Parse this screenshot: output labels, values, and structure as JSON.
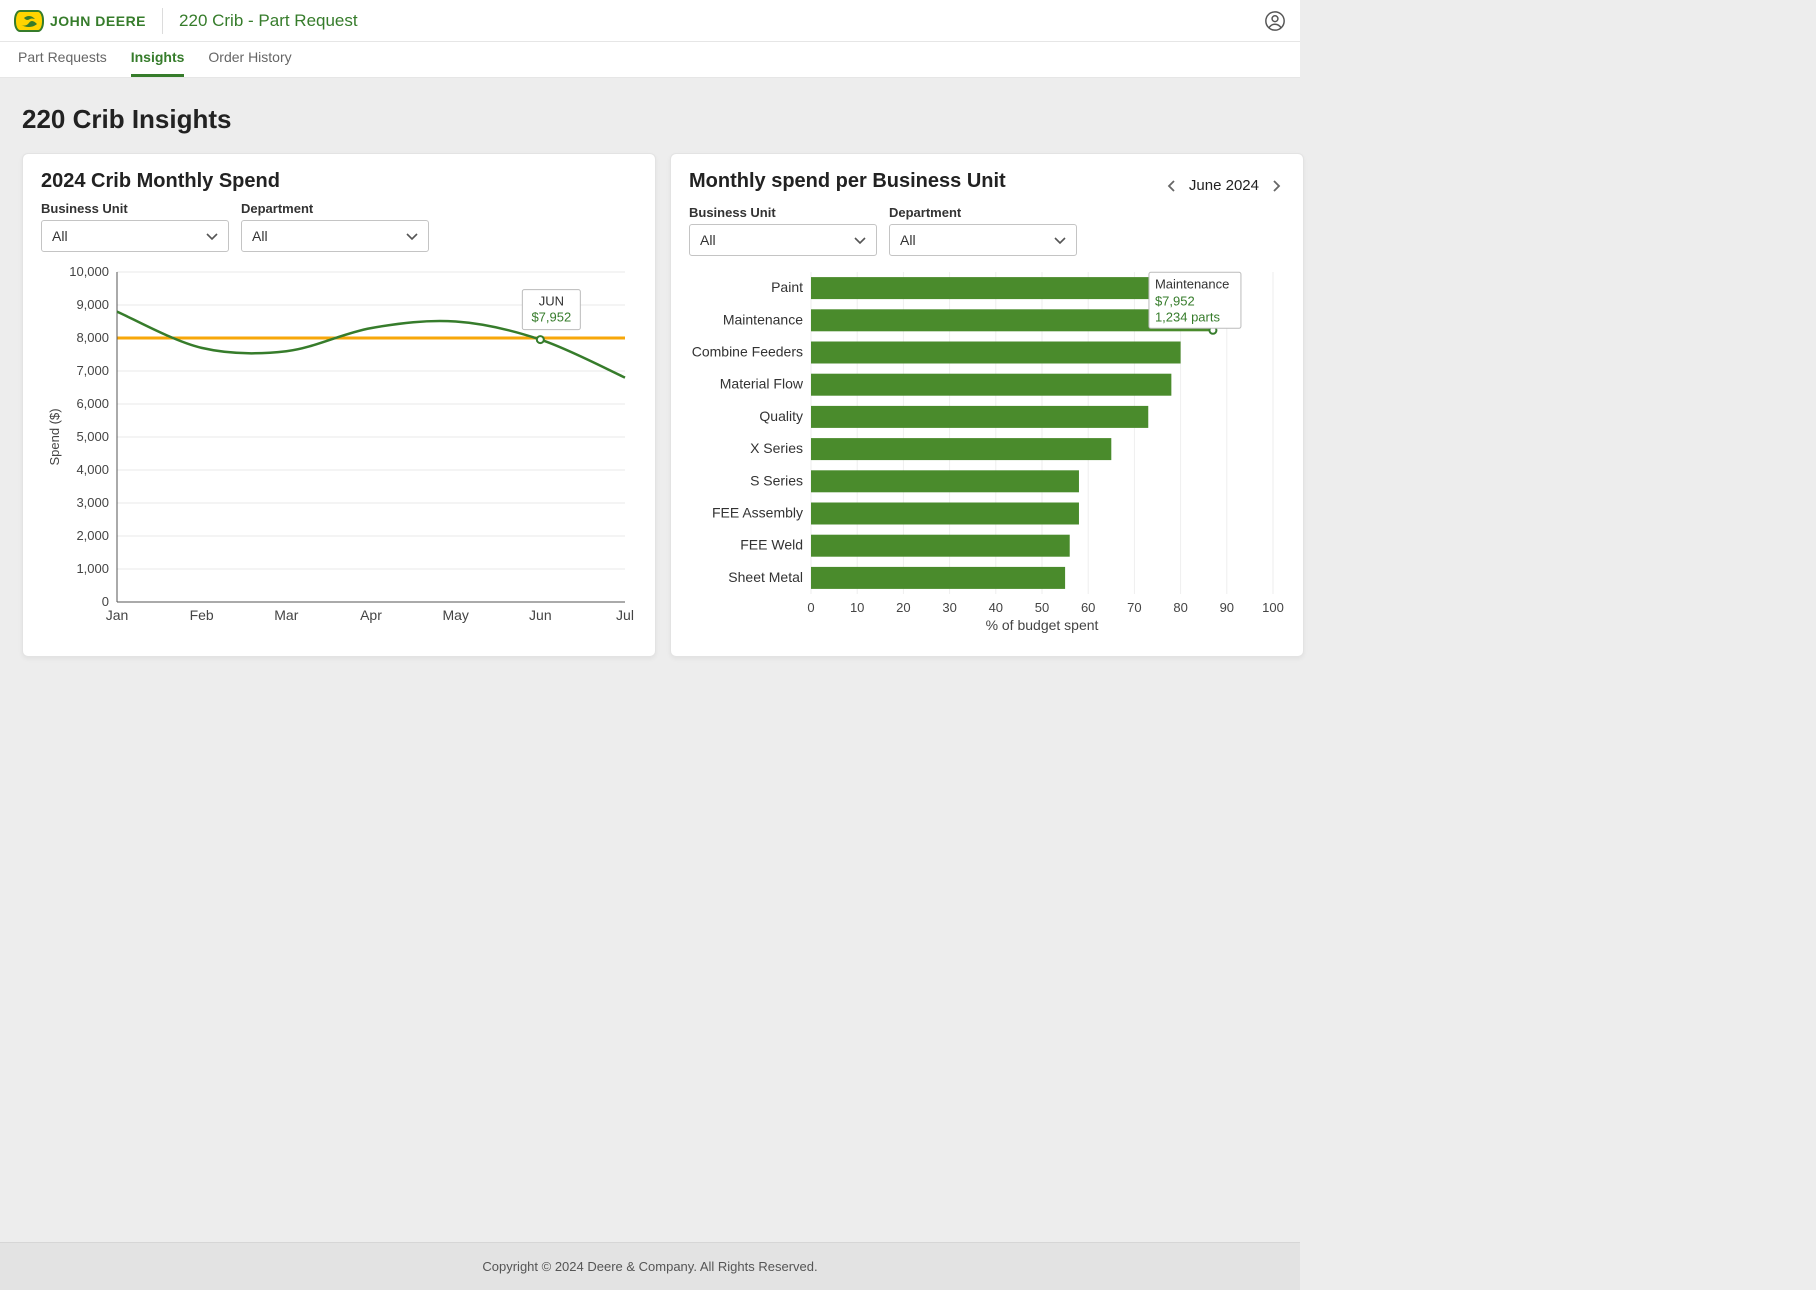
{
  "header": {
    "brand": "JOHN DEERE",
    "title": "220 Crib - Part Request"
  },
  "tabs": [
    {
      "id": "part-requests",
      "label": "Part Requests",
      "active": false
    },
    {
      "id": "insights",
      "label": "Insights",
      "active": true
    },
    {
      "id": "order-history",
      "label": "Order History",
      "active": false
    }
  ],
  "page": {
    "title": "220 Crib Insights"
  },
  "cards": {
    "spend": {
      "title": "2024 Crib Monthly Spend",
      "filters": {
        "business_unit_label": "Business Unit",
        "business_unit_value": "All",
        "department_label": "Department",
        "department_value": "All"
      },
      "tooltip": {
        "label": "JUN",
        "value": "$7,952"
      }
    },
    "bu": {
      "title": "Monthly spend per Business Unit",
      "month_label": "June 2024",
      "filters": {
        "business_unit_label": "Business Unit",
        "business_unit_value": "All",
        "department_label": "Department",
        "department_value": "All"
      },
      "tooltip": {
        "title": "Maintenance",
        "l1": "$7,952",
        "l2": "1,234 parts"
      }
    }
  },
  "footer": {
    "text": "Copyright © 2024 Deere & Company. All Rights Reserved."
  },
  "chart_data": [
    {
      "id": "monthly_spend_line",
      "type": "line",
      "title": "2024 Crib Monthly Spend",
      "xlabel": "",
      "ylabel": "Spend ($)",
      "categories": [
        "Jan",
        "Feb",
        "Mar",
        "Apr",
        "May",
        "Jun",
        "Jul"
      ],
      "values": [
        8800,
        7700,
        7600,
        8300,
        8500,
        7952,
        6800
      ],
      "reference_line": 8000,
      "ylim": [
        0,
        10000
      ],
      "xtick_labels": [
        "Jan",
        "Feb",
        "Mar",
        "Apr",
        "May",
        "Jun",
        "Jul"
      ],
      "ytick_labels": [
        "0",
        "1,000",
        "2,000",
        "3,000",
        "4,000",
        "5,000",
        "6,000",
        "7,000",
        "8,000",
        "9,000",
        "10,000"
      ],
      "highlight": {
        "category": "Jun",
        "label": "JUN",
        "value_label": "$7,952"
      }
    },
    {
      "id": "bu_budget_bar",
      "type": "bar",
      "orientation": "horizontal",
      "title": "Monthly spend per Business Unit",
      "month": "June 2024",
      "xlabel": "% of budget spent",
      "ylabel": "",
      "xlim": [
        0,
        100
      ],
      "xticks": [
        0,
        10,
        20,
        30,
        40,
        50,
        60,
        70,
        80,
        90,
        100
      ],
      "categories": [
        "Paint",
        "Maintenance",
        "Combine Feeders",
        "Material Flow",
        "Quality",
        "X Series",
        "S Series",
        "FEE Assembly",
        "FEE Weld",
        "Sheet Metal"
      ],
      "values": [
        90,
        87,
        80,
        78,
        73,
        65,
        58,
        58,
        56,
        55
      ],
      "highlight": {
        "category": "Maintenance",
        "tooltip": {
          "title": "Maintenance",
          "spend": "$7,952",
          "parts": "1,234 parts"
        }
      }
    }
  ]
}
